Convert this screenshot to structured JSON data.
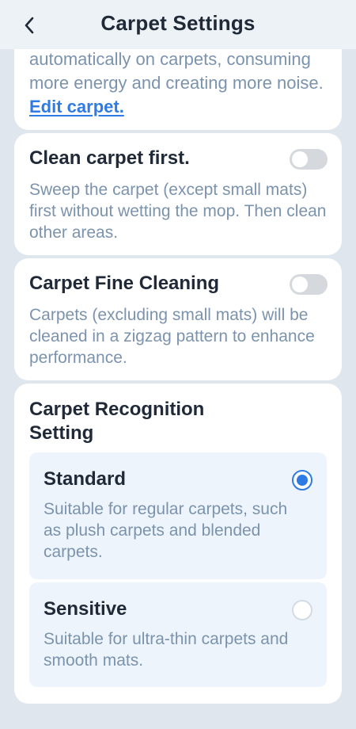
{
  "header": {
    "title": "Carpet Settings",
    "back_icon": "chevron-left-icon"
  },
  "carpet_boost": {
    "description": "automatically on carpets, consuming more energy and creating more noise.",
    "edit_link": "Edit carpet."
  },
  "clean_carpet_first": {
    "title": "Clean carpet first.",
    "description": "Sweep the carpet (except small mats) first without wetting the mop. Then clean other areas.",
    "enabled": false
  },
  "carpet_fine_cleaning": {
    "title": "Carpet Fine Cleaning",
    "description": "Carpets (excluding small mats) will be cleaned in a zigzag pattern to enhance performance.",
    "enabled": false
  },
  "recognition": {
    "title": "Carpet Recognition Setting",
    "options": [
      {
        "label": "Standard",
        "description": "Suitable for regular carpets, such as plush carpets and blended carpets.",
        "selected": true
      },
      {
        "label": "Sensitive",
        "description": "Suitable for ultra-thin carpets and smooth mats.",
        "selected": false
      }
    ]
  },
  "colors": {
    "accent": "#2f7be6",
    "background": "#dfe6ee",
    "card": "#ffffff",
    "option_bg": "#eef4fb",
    "title_text": "#1f2937",
    "desc_text": "#7b93ad",
    "toggle_off": "#d5d9de"
  }
}
